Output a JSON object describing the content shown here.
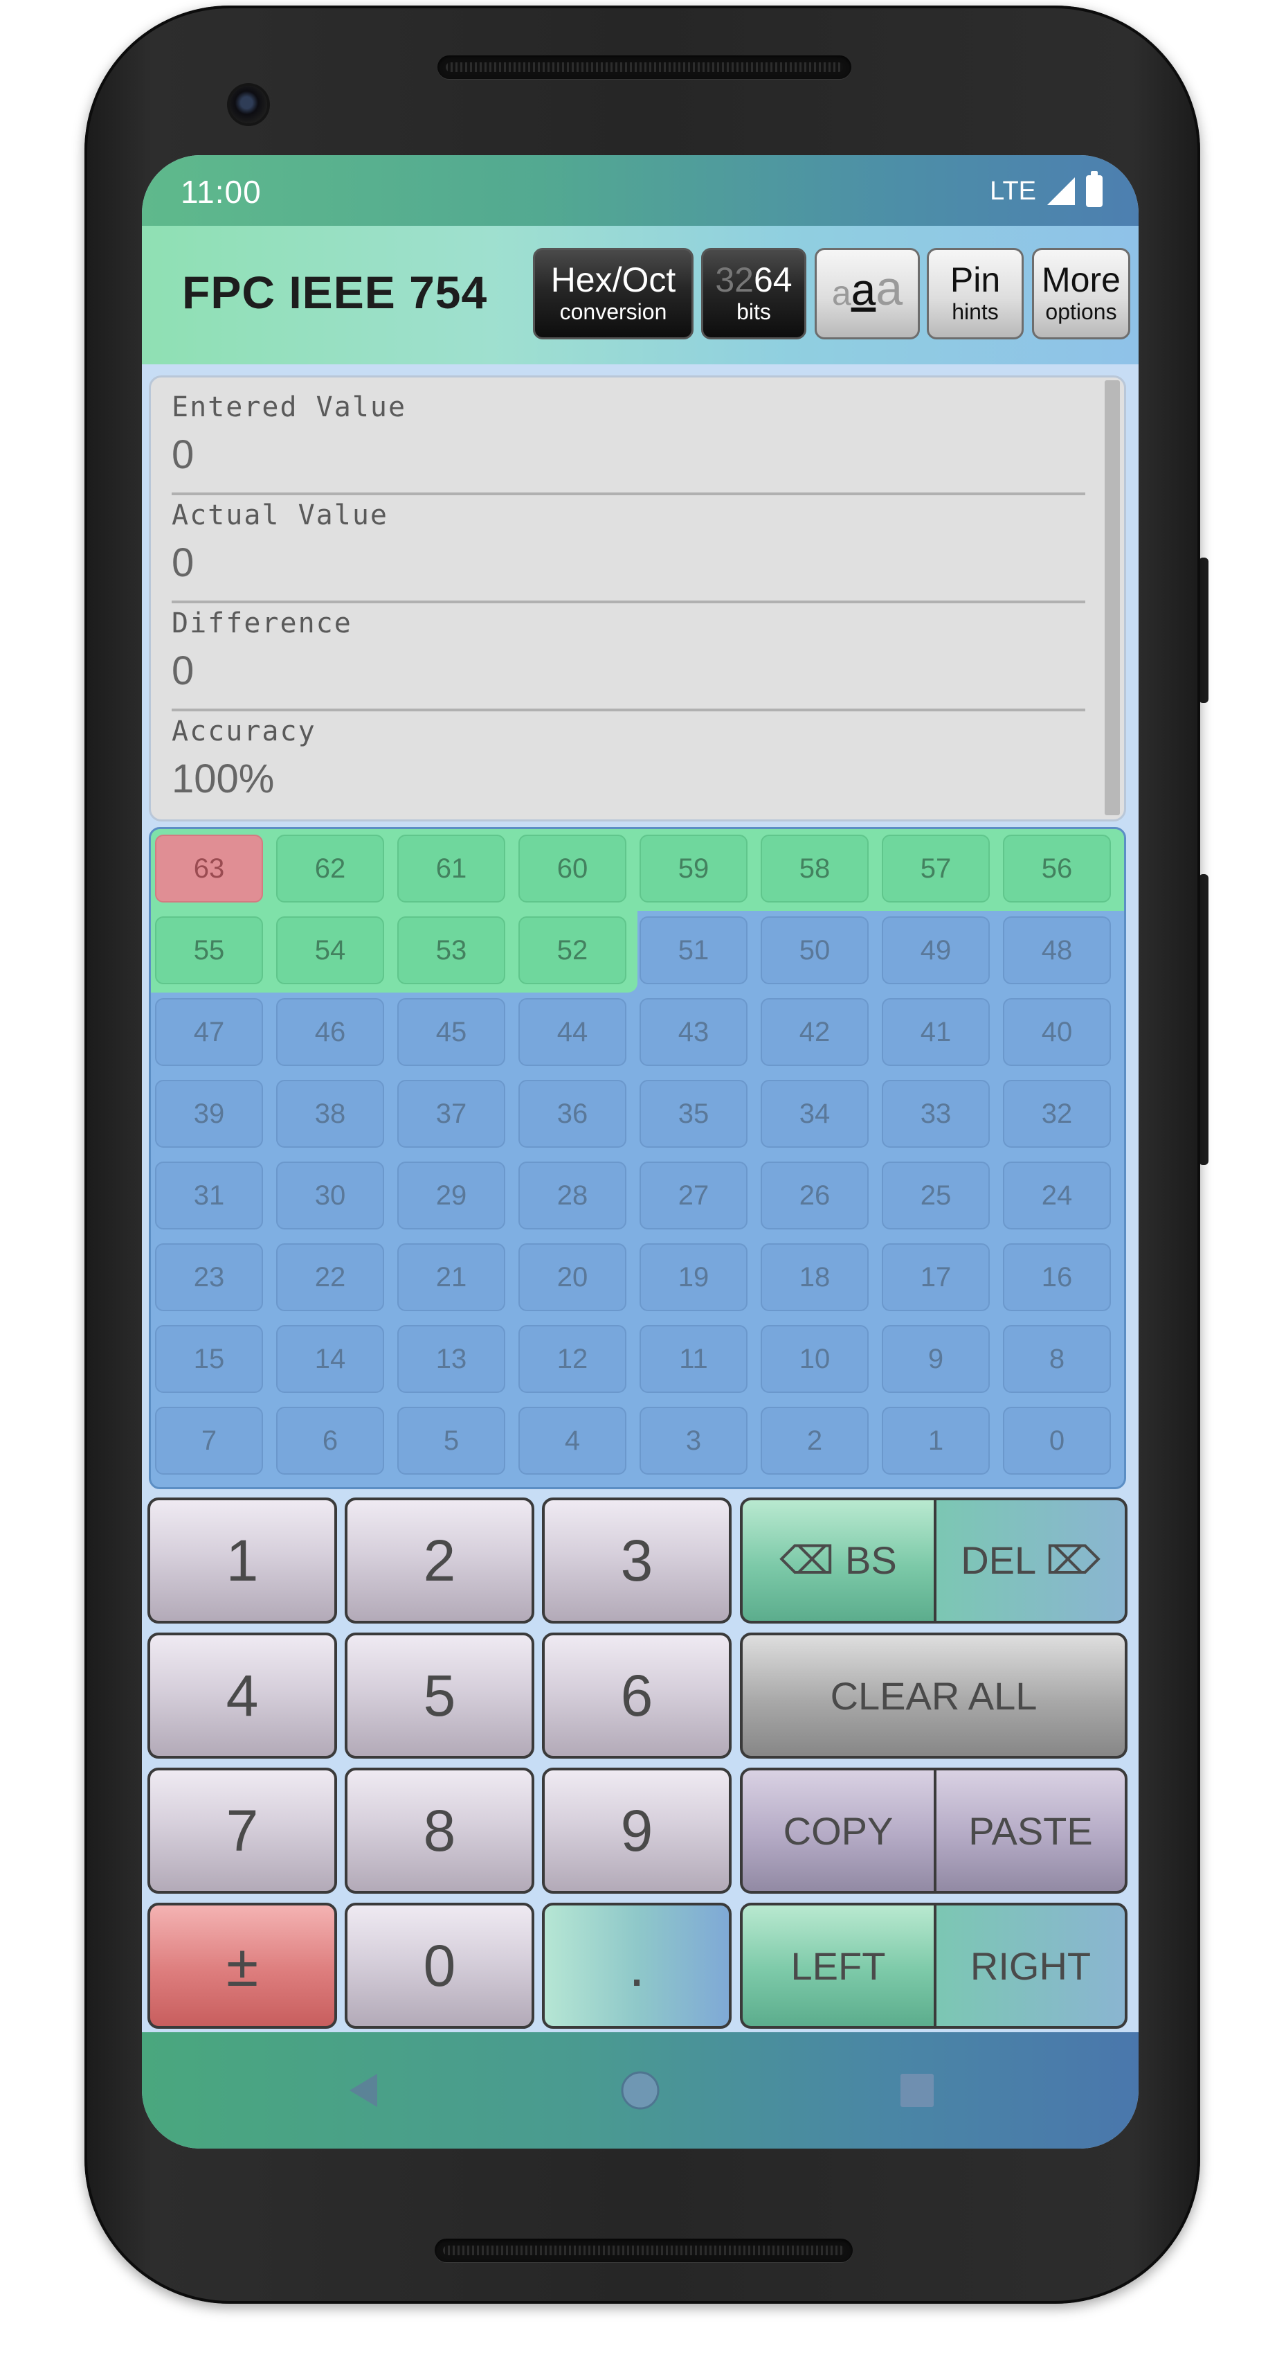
{
  "status": {
    "time": "11:00",
    "network": "LTE",
    "icons": [
      "signal-icon",
      "battery-icon"
    ]
  },
  "app": {
    "title": "FPC IEEE 754",
    "buttons": {
      "hexoct": {
        "line1": "Hex/Oct",
        "line2": "conversion"
      },
      "bits": {
        "line1_dim": "32",
        "line1": "64",
        "line2": "bits"
      },
      "fontsize": {
        "left": "a",
        "mid": "a",
        "right": "a"
      },
      "pin": {
        "line1": "Pin",
        "line2": "hints"
      },
      "more": {
        "line1": "More",
        "line2": "options"
      }
    }
  },
  "panel": {
    "entered_label": "Entered Value",
    "entered_value": "0",
    "actual_label": "Actual Value",
    "actual_value": "0",
    "difference_label": "Difference",
    "difference_value": "0",
    "accuracy_label": "Accuracy",
    "accuracy_value": "100%"
  },
  "bits": {
    "labels": [
      "63",
      "62",
      "61",
      "60",
      "59",
      "58",
      "57",
      "56",
      "55",
      "54",
      "53",
      "52",
      "51",
      "50",
      "49",
      "48",
      "47",
      "46",
      "45",
      "44",
      "43",
      "42",
      "41",
      "40",
      "39",
      "38",
      "37",
      "36",
      "35",
      "34",
      "33",
      "32",
      "31",
      "30",
      "29",
      "28",
      "27",
      "26",
      "25",
      "24",
      "23",
      "22",
      "21",
      "20",
      "19",
      "18",
      "17",
      "16",
      "15",
      "14",
      "13",
      "12",
      "11",
      "10",
      "9",
      "8",
      "7",
      "6",
      "5",
      "4",
      "3",
      "2",
      "1",
      "0"
    ],
    "sign_bits": 1,
    "exponent_bits": 11,
    "mantissa_bits": 52
  },
  "keys": {
    "k1": "1",
    "k2": "2",
    "k3": "3",
    "k4": "4",
    "k5": "5",
    "k6": "6",
    "k7": "7",
    "k8": "8",
    "k9": "9",
    "sign": "±",
    "k0": "0",
    "dot": ".",
    "bs": "⌫ BS",
    "del": "DEL ⌦",
    "clear_all": "CLEAR ALL",
    "copy": "COPY",
    "paste": "PASTE",
    "left": "LEFT",
    "right": "RIGHT"
  },
  "nav": {
    "icons": [
      "back-icon",
      "home-icon",
      "recents-icon"
    ]
  },
  "colors": {
    "sign": "#e08e94",
    "exponent": "#6fd79d",
    "mantissa": "#78a7dc"
  }
}
